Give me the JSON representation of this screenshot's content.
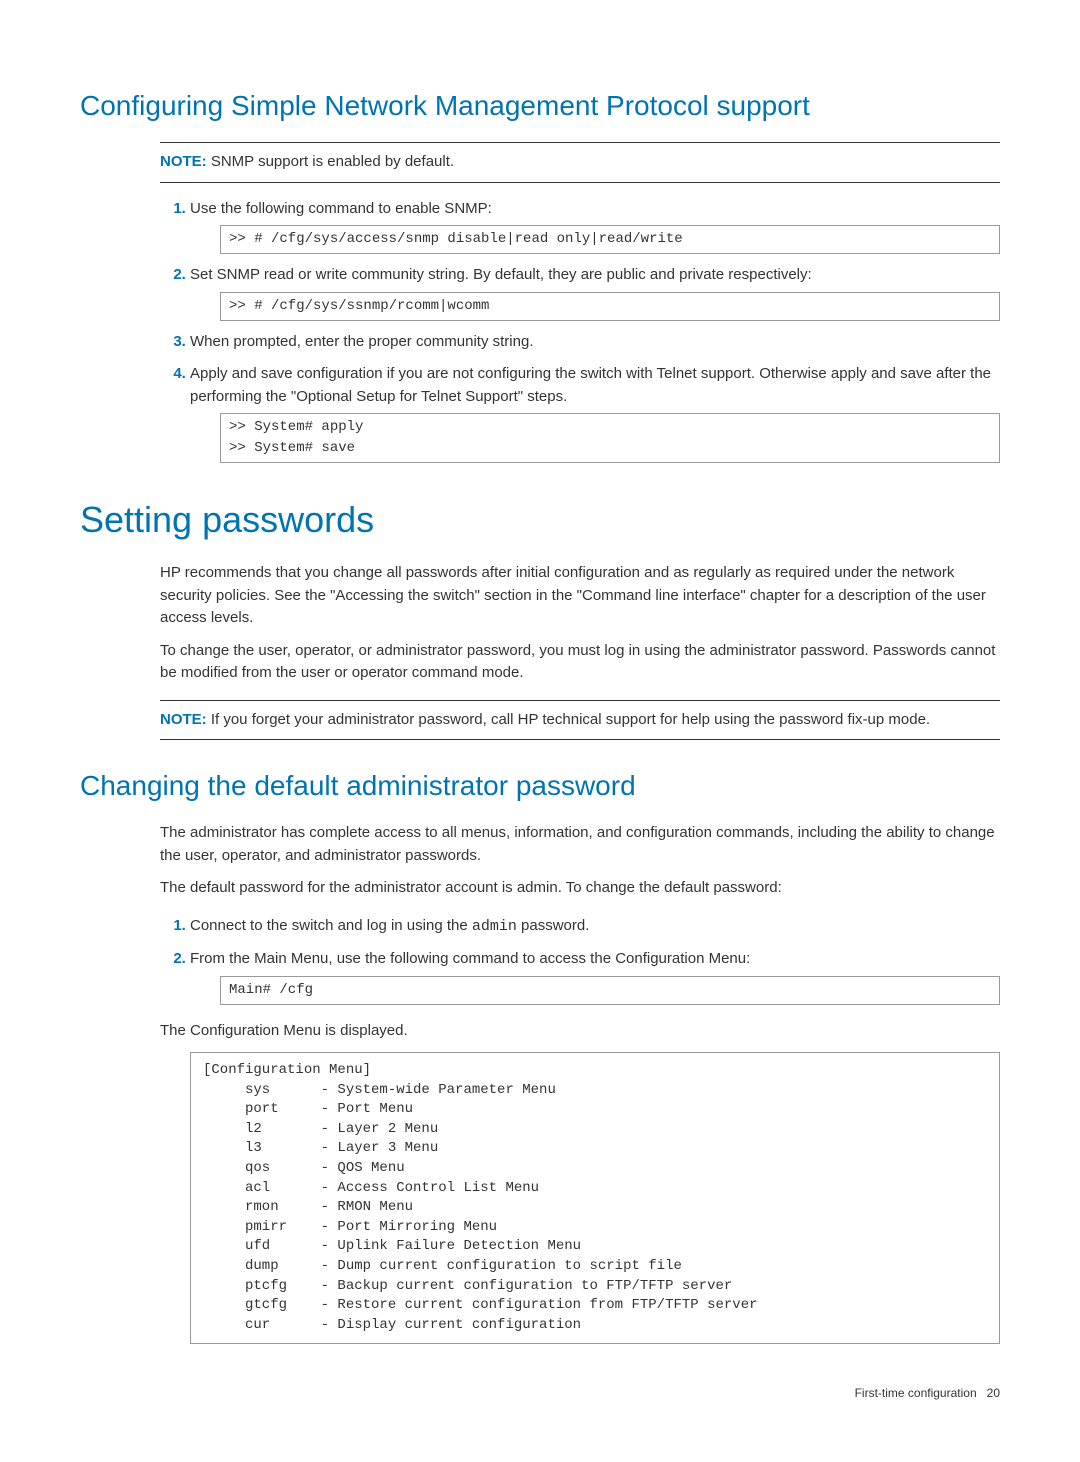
{
  "section1": {
    "title": "Configuring Simple Network Management Protocol support",
    "note": {
      "label": "NOTE:",
      "text": " SNMP support is enabled by default."
    },
    "steps": [
      {
        "text": "Use the following command to enable SNMP:",
        "code": ">> # /cfg/sys/access/snmp disable|read only|read/write"
      },
      {
        "text": "Set SNMP read or write community string. By default, they are public and private respectively:",
        "code": ">> # /cfg/sys/ssnmp/rcomm|wcomm"
      },
      {
        "text": "When prompted, enter the proper community string."
      },
      {
        "text": "Apply and save configuration if you are not configuring the switch with Telnet support. Otherwise apply and save after the performing the \"Optional Setup for Telnet Support\" steps.",
        "code": ">> System# apply\n>> System# save"
      }
    ]
  },
  "section2": {
    "title": "Setting passwords",
    "para1": "HP recommends that you change all passwords after initial configuration and as regularly as required under the network security policies. See the \"Accessing the switch\" section in the \"Command line interface\" chapter for a description of the user access levels.",
    "para2": "To change the user, operator, or administrator password, you must log in using the administrator password. Passwords cannot be modified from the user or operator command mode.",
    "note": {
      "label": "NOTE:",
      "text": " If you forget your administrator password, call HP technical support for help using the password fix-up mode."
    }
  },
  "section3": {
    "title": "Changing the default administrator password",
    "para1": "The administrator has complete access to all menus, information, and configuration commands, including the ability to change the user, operator, and administrator passwords.",
    "para2": "The default password for the administrator account is admin. To change the default password:",
    "steps": [
      {
        "text_before": "Connect to the switch and log in using the ",
        "code_inline": "admin",
        "text_after": " password."
      },
      {
        "text": "From the Main Menu, use the following command to access the Configuration Menu:",
        "code": "Main# /cfg"
      }
    ],
    "menu_intro": "The Configuration Menu is displayed.",
    "config_menu": "[Configuration Menu]\n     sys      - System-wide Parameter Menu\n     port     - Port Menu\n     l2       - Layer 2 Menu\n     l3       - Layer 3 Menu\n     qos      - QOS Menu\n     acl      - Access Control List Menu\n     rmon     - RMON Menu\n     pmirr    - Port Mirroring Menu\n     ufd      - Uplink Failure Detection Menu\n     dump     - Dump current configuration to script file\n     ptcfg    - Backup current configuration to FTP/TFTP server\n     gtcfg    - Restore current configuration from FTP/TFTP server\n     cur      - Display current configuration\n"
  },
  "footer": {
    "text": "First-time configuration",
    "page": "20"
  }
}
